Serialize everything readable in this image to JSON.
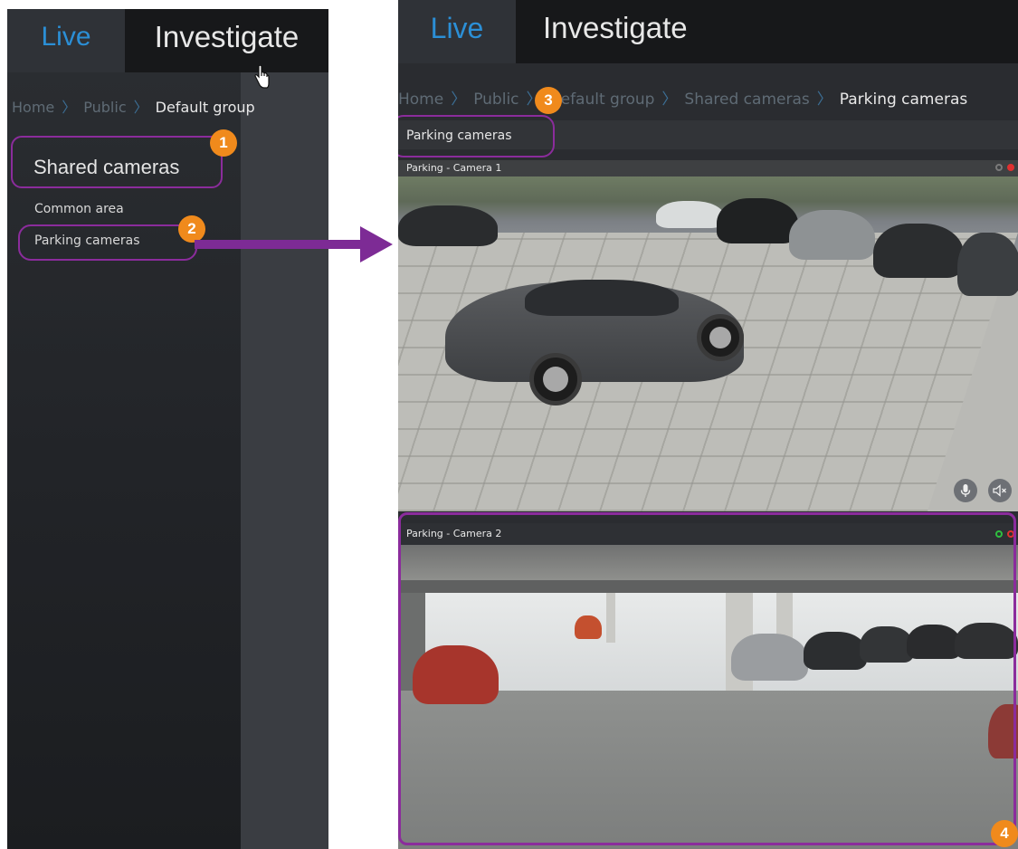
{
  "left_panel": {
    "tabs": {
      "live": "Live",
      "investigate": "Investigate"
    },
    "breadcrumb": [
      {
        "label": "Home"
      },
      {
        "label": "Public"
      },
      {
        "label": "Default group"
      }
    ],
    "group_title": "Shared cameras",
    "items": [
      {
        "label": "Common area"
      },
      {
        "label": "Parking cameras"
      }
    ]
  },
  "right_panel": {
    "tabs": {
      "live": "Live",
      "investigate": "Investigate"
    },
    "breadcrumb": [
      {
        "label": "Home"
      },
      {
        "label": "Public"
      },
      {
        "label": "Default group"
      },
      {
        "label": "Shared cameras"
      },
      {
        "label": "Parking cameras"
      }
    ],
    "view_title": "Parking cameras",
    "cameras": [
      {
        "title": "Parking - Camera 1"
      },
      {
        "title": "Parking - Camera 2"
      }
    ]
  },
  "callouts": [
    "1",
    "2",
    "3",
    "4"
  ],
  "colors": {
    "live_tab": "#2b8fd6",
    "callout_badge": "#f08a1c",
    "highlight_outline": "#8b2c9c",
    "arrow": "#7d2b95",
    "status_ok": "#2fbf3f",
    "status_rec": "#e03030"
  },
  "icons": {
    "cursor": "hand-pointer-icon",
    "microphone": "microphone-icon",
    "speaker": "speaker-mute-icon"
  }
}
